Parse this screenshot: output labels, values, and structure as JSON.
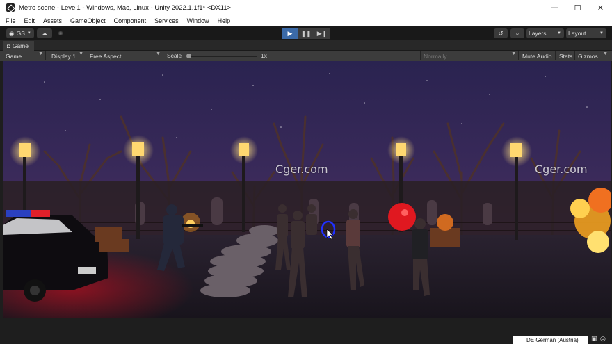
{
  "window": {
    "title": "Metro scene - Level1 - Windows, Mac, Linux - Unity 2022.1.1f1* <DX11>",
    "minimize": "—",
    "maximize": "☐",
    "close": "✕"
  },
  "menu": [
    "File",
    "Edit",
    "Assets",
    "GameObject",
    "Component",
    "Services",
    "Window",
    "Help"
  ],
  "toolbar": {
    "account": "GS",
    "layers": "Layers",
    "layout": "Layout"
  },
  "game_tab": {
    "label": "Game"
  },
  "game_bar": {
    "view": "Game",
    "display": "Display 1",
    "aspect": "Free Aspect",
    "scale_label": "Scale",
    "scale_value": "1x",
    "vsync": "Normally",
    "mute": "Mute Audio",
    "stats": "Stats",
    "gizmos": "Gizmos"
  },
  "watermarks": [
    "Cger.com",
    "Cger.com"
  ],
  "taskbar": {
    "language": "DE German (Austria)"
  },
  "colors": {
    "play_active": "#3b6aa8",
    "sky_top": "#2a2350",
    "sky_glow": "#6a2a6a",
    "police_light_red": "#e0202a",
    "police_light_blue": "#2050e0",
    "fire": "#f0a020"
  }
}
